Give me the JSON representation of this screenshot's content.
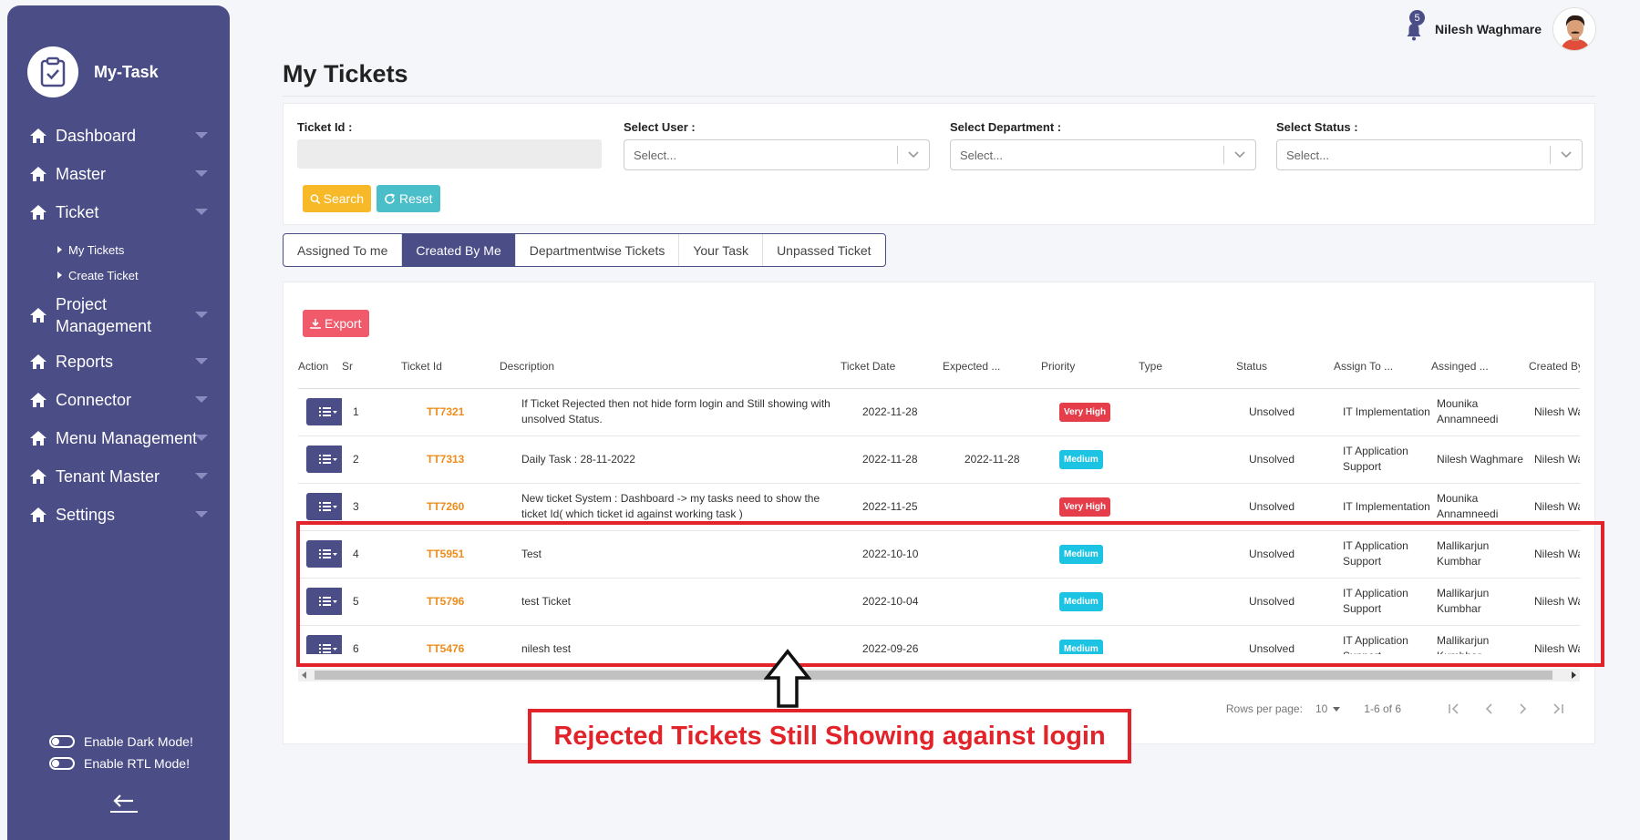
{
  "app": {
    "name": "My-Task"
  },
  "sidebar": {
    "items": [
      {
        "label": "Dashboard"
      },
      {
        "label": "Master"
      },
      {
        "label": "Ticket"
      },
      {
        "label": "Project Management"
      },
      {
        "label": "Reports"
      },
      {
        "label": "Connector"
      },
      {
        "label": "Menu Management"
      },
      {
        "label": "Tenant Master"
      },
      {
        "label": "Settings"
      }
    ],
    "ticket_sub": [
      {
        "label": "My Tickets"
      },
      {
        "label": "Create Ticket"
      }
    ],
    "dark_mode_label": "Enable Dark Mode!",
    "rtl_mode_label": "Enable RTL Mode!"
  },
  "header": {
    "notification_count": "5",
    "user_name": "Nilesh Waghmare"
  },
  "page": {
    "title": "My Tickets"
  },
  "filters": {
    "ticket_id_label": "Ticket Id :",
    "user_label": "Select User :",
    "department_label": "Select Department :",
    "status_label": "Select Status :",
    "select_placeholder": "Select...",
    "search_label": "Search",
    "reset_label": "Reset"
  },
  "tabs": [
    {
      "label": "Assigned To me",
      "active": false
    },
    {
      "label": "Created By Me",
      "active": true
    },
    {
      "label": "Departmentwise Tickets",
      "active": false
    },
    {
      "label": "Your Task",
      "active": false
    },
    {
      "label": "Unpassed Ticket",
      "active": false
    }
  ],
  "table": {
    "export_label": "Export",
    "columns": [
      "Action",
      "Sr",
      "Ticket Id",
      "Description",
      "Ticket Date",
      "Expected ...",
      "Priority",
      "Type",
      "Status",
      "Assign To ...",
      "Assinged ...",
      "Created By"
    ],
    "rows": [
      {
        "sr": "1",
        "ticket_id": "TT7321",
        "description": "If Ticket Rejected then not hide form login and Still showing with unsolved Status.",
        "ticket_date": "2022-11-28",
        "expected": "",
        "priority": "Very High",
        "type": "",
        "status": "Unsolved",
        "assign_to": "IT Implementation",
        "assigned": "Mounika Annamneedi",
        "created_by": "Nilesh Waghmare"
      },
      {
        "sr": "2",
        "ticket_id": "TT7313",
        "description": "Daily Task : 28-11-2022",
        "ticket_date": "2022-11-28",
        "expected": "2022-11-28",
        "priority": "Medium",
        "type": "",
        "status": "Unsolved",
        "assign_to": "IT Application Support",
        "assigned": "Nilesh Waghmare",
        "created_by": "Nilesh Waghmare"
      },
      {
        "sr": "3",
        "ticket_id": "TT7260",
        "description": "New ticket System : Dashboard -> my tasks need to show the ticket Id( which ticket id against working task )",
        "ticket_date": "2022-11-25",
        "expected": "",
        "priority": "Very High",
        "type": "",
        "status": "Unsolved",
        "assign_to": "IT Implementation",
        "assigned": "Mounika Annamneedi",
        "created_by": "Nilesh Waghmare"
      },
      {
        "sr": "4",
        "ticket_id": "TT5951",
        "description": "Test",
        "ticket_date": "2022-10-10",
        "expected": "",
        "priority": "Medium",
        "type": "",
        "status": "Unsolved",
        "assign_to": "IT Application Support",
        "assigned": "Mallikarjun Kumbhar",
        "created_by": "Nilesh Waghmare"
      },
      {
        "sr": "5",
        "ticket_id": "TT5796",
        "description": "test Ticket",
        "ticket_date": "2022-10-04",
        "expected": "",
        "priority": "Medium",
        "type": "",
        "status": "Unsolved",
        "assign_to": "IT Application Support",
        "assigned": "Mallikarjun Kumbhar",
        "created_by": "Nilesh Waghmare"
      },
      {
        "sr": "6",
        "ticket_id": "TT5476",
        "description": "nilesh test",
        "ticket_date": "2022-09-26",
        "expected": "",
        "priority": "Medium",
        "type": "",
        "status": "Unsolved",
        "assign_to": "IT Application Support",
        "assigned": "Mallikarjun Kumbhar",
        "created_by": "Nilesh Waghmare"
      }
    ]
  },
  "pagination": {
    "rows_per_page_label": "Rows per page:",
    "rows_per_page": "10",
    "range": "1-6 of 6"
  },
  "annotation": {
    "text": "Rejected Tickets Still Showing against login"
  },
  "colors": {
    "sidebar": "#4b4d86",
    "accent_orange": "#ef8c1a",
    "very_high": "#e53e4a",
    "medium": "#1cc3e3",
    "annotation_red": "#e2232a"
  }
}
